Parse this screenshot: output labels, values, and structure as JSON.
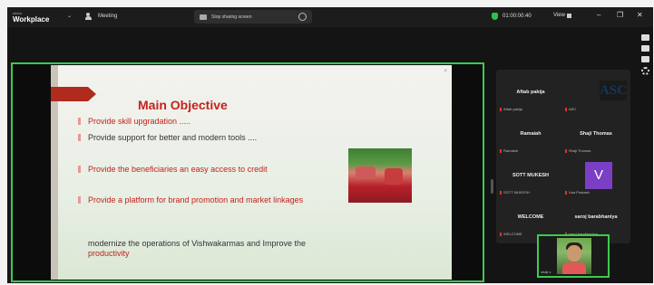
{
  "titlebar": {
    "brand_top": "zoom",
    "brand": "Workplace",
    "meeting_label": "Meeting",
    "share_label": "Stop sharing screen",
    "timer": "01:00:00:40",
    "view_label": "View",
    "controls": {
      "minimize": "–",
      "restore": "❐",
      "close": "✕"
    }
  },
  "slide": {
    "title": "Main Objective",
    "bullets": [
      {
        "text": "Provide skill upgradation .....",
        "color": "red"
      },
      {
        "text": "Provide support for better and modern tools ....",
        "color": "dark"
      },
      {
        "text": "Provide the beneficiaries an easy access to credit",
        "color": "red"
      },
      {
        "text": "Provide a platform for brand promotion and market linkages",
        "color": "red"
      }
    ],
    "closing_text": "modernize the operations of Vishwakarmas and Improve the ",
    "closing_highlight": "productivity"
  },
  "participants": [
    {
      "name": "Aftab pakija",
      "label": "Aftab pakija"
    },
    {
      "name": "",
      "label": "ASC",
      "logo_text": "ASC"
    },
    {
      "name": "Ramaiah",
      "label": "Ramaiah"
    },
    {
      "name": "Shaji Thomas",
      "label": "Shaji Thomas"
    },
    {
      "name": "SOTT MUKESH",
      "label": "SOTT MUKESH"
    },
    {
      "name": "",
      "label": "Usa Prakash",
      "avatar_letter": "V"
    },
    {
      "name": "WELCOME",
      "label": "WELCOME"
    },
    {
      "name": "saroj barabhaniya",
      "label": "saroj barabhaniya"
    }
  ],
  "self_view": {
    "label": "shaji s"
  },
  "colors": {
    "accent_green": "#3bcb4f",
    "slide_red": "#c4221b",
    "avatar_purple": "#7a3fc4"
  }
}
